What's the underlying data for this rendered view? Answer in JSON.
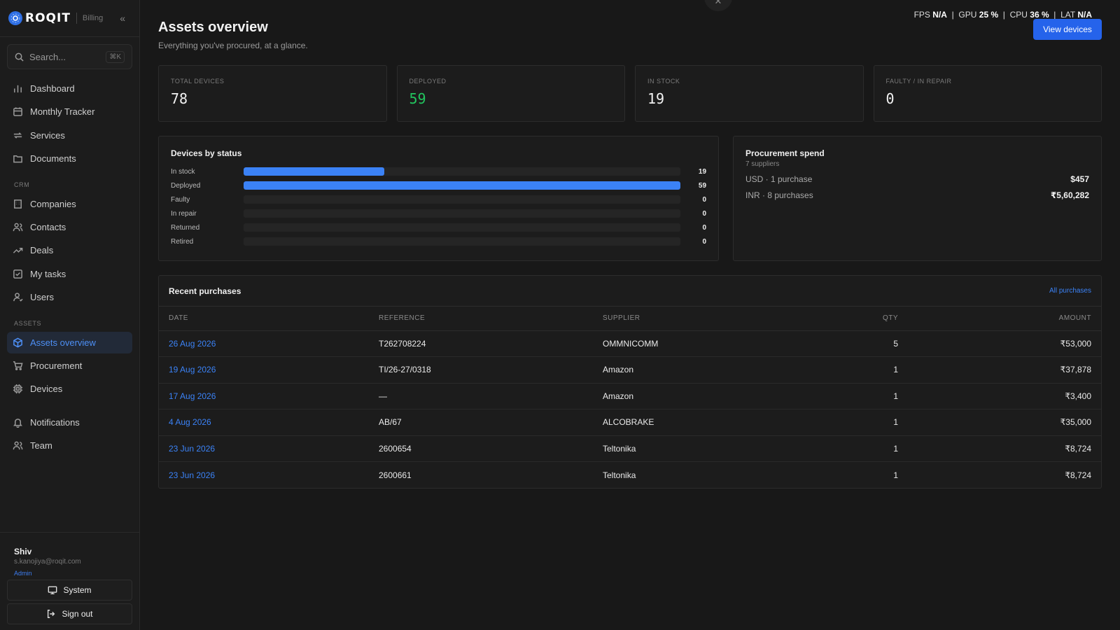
{
  "brand": {
    "logo_text": "ROQIT",
    "section": "Billing"
  },
  "search": {
    "placeholder": "Search...",
    "shortcut": "⌘K"
  },
  "nav": {
    "main": [
      {
        "label": "Dashboard",
        "icon": "bar-chart-icon"
      },
      {
        "label": "Monthly Tracker",
        "icon": "calendar-icon"
      },
      {
        "label": "Services",
        "icon": "repeat-icon"
      },
      {
        "label": "Documents",
        "icon": "folder-icon"
      }
    ],
    "crm_label": "CRM",
    "crm": [
      {
        "label": "Companies",
        "icon": "building-icon"
      },
      {
        "label": "Contacts",
        "icon": "users-icon"
      },
      {
        "label": "Deals",
        "icon": "trending-up-icon"
      },
      {
        "label": "My tasks",
        "icon": "check-square-icon"
      },
      {
        "label": "Users",
        "icon": "user-icon"
      }
    ],
    "assets_label": "ASSETS",
    "assets": [
      {
        "label": "Assets overview",
        "icon": "box-icon",
        "active": true
      },
      {
        "label": "Procurement",
        "icon": "cart-icon"
      },
      {
        "label": "Devices",
        "icon": "chip-icon"
      }
    ],
    "footer": [
      {
        "label": "Notifications",
        "icon": "bell-icon"
      },
      {
        "label": "Team",
        "icon": "team-icon"
      }
    ]
  },
  "user": {
    "name": "Shiv",
    "email": "s.kanojiya@roqit.com",
    "role": "Admin",
    "system_label": "System",
    "signout_label": "Sign out"
  },
  "perf": {
    "fps_label": "FPS",
    "fps": "N/A",
    "gpu_label": "GPU",
    "gpu": "25 %",
    "cpu_label": "CPU",
    "cpu": "36 %",
    "lat_label": "LAT",
    "lat": "N/A"
  },
  "page": {
    "title": "Assets overview",
    "subtitle": "Everything you've procured, at a glance.",
    "view_button": "View devices"
  },
  "stats": [
    {
      "label": "TOTAL DEVICES",
      "value": "78"
    },
    {
      "label": "DEPLOYED",
      "value": "59"
    },
    {
      "label": "IN STOCK",
      "value": "19"
    },
    {
      "label": "FAULTY / IN REPAIR",
      "value": "0"
    }
  ],
  "status": {
    "title": "Devices by status",
    "max": 59,
    "rows": [
      {
        "label": "In stock",
        "value": 19
      },
      {
        "label": "Deployed",
        "value": 59
      },
      {
        "label": "Faulty",
        "value": 0
      },
      {
        "label": "In repair",
        "value": 0
      },
      {
        "label": "Returned",
        "value": 0
      },
      {
        "label": "Retired",
        "value": 0
      }
    ]
  },
  "spend": {
    "title": "Procurement spend",
    "subtitle": "7 suppliers",
    "rows": [
      {
        "label": "USD · 1 purchase",
        "amount": "$457"
      },
      {
        "label": "INR · 8 purchases",
        "amount": "₹5,60,282"
      }
    ]
  },
  "purchases": {
    "title": "Recent purchases",
    "link": "All purchases",
    "columns": [
      "DATE",
      "REFERENCE",
      "SUPPLIER",
      "QTY",
      "AMOUNT"
    ],
    "rows": [
      {
        "date": "26 Aug 2026",
        "reference": "T262708224",
        "supplier": "OMMNICOMM",
        "qty": "5",
        "amount": "₹53,000"
      },
      {
        "date": "19 Aug 2026",
        "reference": "TI/26-27/0318",
        "supplier": "Amazon",
        "qty": "1",
        "amount": "₹37,878"
      },
      {
        "date": "17 Aug 2026",
        "reference": "—",
        "supplier": "Amazon",
        "qty": "1",
        "amount": "₹3,400"
      },
      {
        "date": "4 Aug 2026",
        "reference": "AB/67",
        "supplier": "ALCOBRAKE",
        "qty": "1",
        "amount": "₹35,000"
      },
      {
        "date": "23 Jun 2026",
        "reference": "2600654",
        "supplier": "Teltonika",
        "qty": "1",
        "amount": "₹8,724"
      },
      {
        "date": "23 Jun 2026",
        "reference": "2600661",
        "supplier": "Teltonika",
        "qty": "1",
        "amount": "₹8,724"
      }
    ]
  },
  "colors": {
    "accent": "#2563eb",
    "deployed": "#22c55e",
    "bar": "#3b82f6"
  }
}
